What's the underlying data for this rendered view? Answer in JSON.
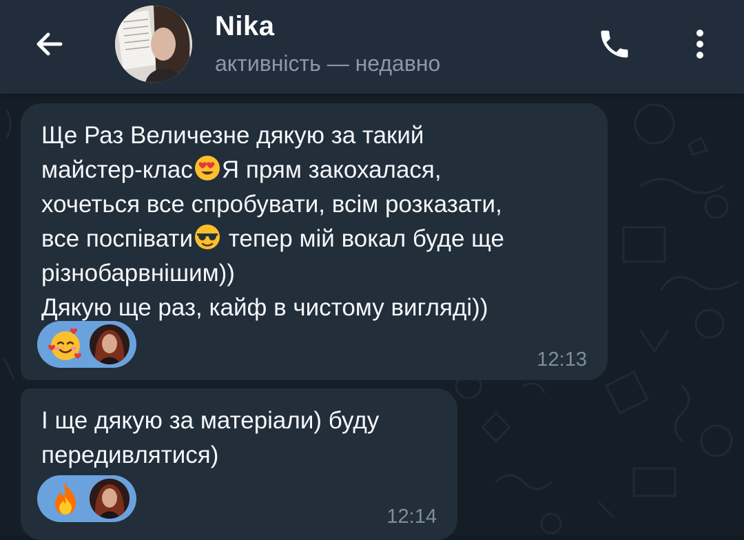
{
  "header": {
    "contact_name": "Nika",
    "status": "активність — недавно",
    "back_icon": "arrow-left-icon",
    "call_icon": "phone-icon",
    "menu_icon": "more-vertical-icon"
  },
  "messages": [
    {
      "lines": [
        "Ще Раз Величезне дякую за такий",
        "майстер-клас",
        "Я прям закохалася,",
        "хочеться все спробувати, всім розказати,",
        "все поспівати",
        " тепер мій вокал буде ще",
        "різнобарвнішим))",
        "Дякую ще раз, кайф в чистому вигляді))"
      ],
      "inline_emojis": [
        "heart-eyes-emoji",
        "sunglasses-emoji"
      ],
      "reaction_emoji": "smiling-face-with-hearts-emoji",
      "time": "12:13"
    },
    {
      "lines": [
        "І ще дякую за матеріали) буду",
        "передивлятися)"
      ],
      "reaction_emoji": "fire-emoji",
      "time": "12:14"
    }
  ],
  "colors": {
    "header_bg": "#212d3b",
    "chat_bg": "#151e27",
    "bubble_bg": "#222e3a",
    "reaction_bg": "#6aa2de",
    "status_text": "#8a98a8",
    "time_text": "#7f8e9d"
  }
}
